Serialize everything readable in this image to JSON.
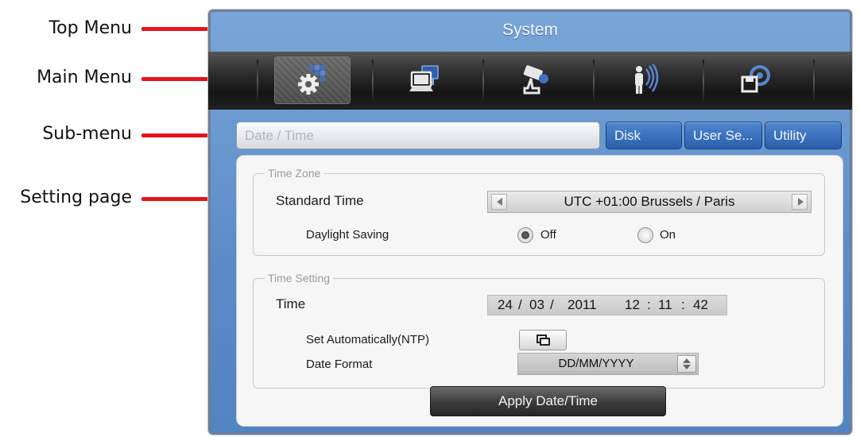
{
  "callouts": {
    "top_menu": "Top Menu",
    "main_menu": "Main Menu",
    "sub_menu": "Sub-menu",
    "setting_page": "Setting page",
    "line_color": "#e4141b"
  },
  "window": {
    "title": "System"
  },
  "main_menu": {
    "items": [
      {
        "icon": "system-gear-icon",
        "active": true
      },
      {
        "icon": "computer-network-icon",
        "active": false
      },
      {
        "icon": "camera-device-icon",
        "active": false
      },
      {
        "icon": "user-signal-icon",
        "active": false
      },
      {
        "icon": "save-disk-icon",
        "active": false
      }
    ]
  },
  "sub_menu": {
    "tabs": [
      {
        "label": "Date / Time",
        "selected": true
      },
      {
        "label": "Disk",
        "selected": false
      },
      {
        "label": "User Se...",
        "selected": false
      },
      {
        "label": "Utility",
        "selected": false
      }
    ]
  },
  "time_zone": {
    "legend": "Time Zone",
    "standard_time_label": "Standard Time",
    "standard_time_value": "UTC +01:00 Brussels / Paris",
    "daylight_saving_label": "Daylight Saving",
    "off_label": "Off",
    "on_label": "On",
    "daylight_saving_selected": "Off"
  },
  "time_setting": {
    "legend": "Time Setting",
    "time_label": "Time",
    "day": "24",
    "month": "03",
    "year": "2011",
    "hour": "12",
    "minute": "11",
    "second": "42",
    "date_sep": "/",
    "time_sep": ":",
    "ntp_label": "Set Automatically(NTP)",
    "date_format_label": "Date Format",
    "date_format_value": "DD/MM/YYYY"
  },
  "actions": {
    "apply_label": "Apply Date/Time"
  }
}
